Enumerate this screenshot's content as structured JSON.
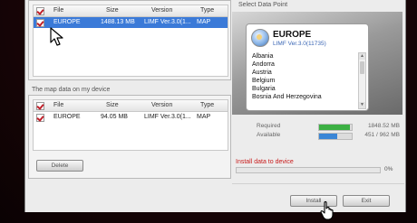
{
  "installed_list": {
    "columns": [
      "File",
      "Size",
      "Version",
      "Type"
    ],
    "rows": [
      {
        "file": "EUROPE",
        "size": "1488.13 MB",
        "version": "LIMF Ver.3.0(1...",
        "type": "MAP",
        "selected": true
      }
    ]
  },
  "device_list": {
    "section_label": "The map data on my device",
    "columns": [
      "File",
      "Size",
      "Version",
      "Type"
    ],
    "rows": [
      {
        "file": "EUROPE",
        "size": "94.05 MB",
        "version": "LIMF Ver.3.0(1...",
        "type": "MAP"
      }
    ],
    "delete_label": "Delete"
  },
  "data_point": {
    "title": "Select Data Point",
    "name": "EUROPE",
    "version": "LIMF Ver.3.0(11735)",
    "countries": [
      "Albania",
      "Andorra",
      "Austria",
      "Belgium",
      "Bulgaria",
      "Bosnia And Herzegovina"
    ],
    "icon": "globe-disc-icon"
  },
  "capacity": {
    "required": {
      "label": "Required",
      "value": "1848.52 MB",
      "fill_fraction": 0.95,
      "color": "#3cb043"
    },
    "available": {
      "label": "Available",
      "value": "451 / 962 MB",
      "fill_fraction": 0.55,
      "color": "#3a86d6"
    }
  },
  "install": {
    "label": "Install data to device",
    "percent_text": "0%",
    "progress_fraction": 0.0,
    "accent_color": "#c81a1a"
  },
  "buttons": {
    "install": "Install",
    "exit": "Exit"
  }
}
